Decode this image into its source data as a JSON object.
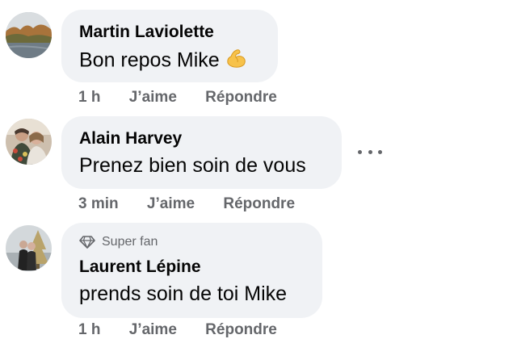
{
  "comments": [
    {
      "author": "Martin Laviolette",
      "text": "Bon repos Mike",
      "emoji": "flexed-biceps",
      "time": "1 h",
      "like": "J’aime",
      "reply": "Répondre"
    },
    {
      "author": "Alain Harvey",
      "text": "Prenez bien soin de vous",
      "time": "3 min",
      "like": "J’aime",
      "reply": "Répondre"
    },
    {
      "badge": "Super fan",
      "author": "Laurent Lépine",
      "text": "prends soin de toi Mike",
      "time": "1 h",
      "like": "J’aime",
      "reply": "Répondre"
    }
  ],
  "colors": {
    "bubble": "#f0f2f5",
    "secondary_text": "#65676b",
    "primary_text": "#050505"
  }
}
